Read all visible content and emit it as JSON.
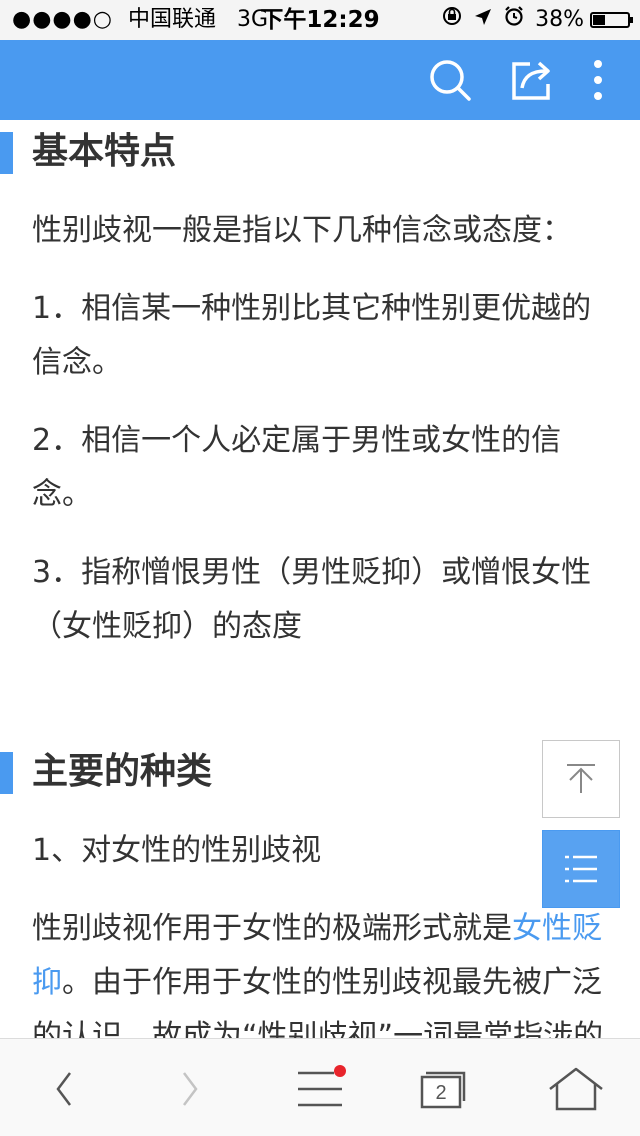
{
  "status_bar": {
    "signal": "●●●●○",
    "carrier": "中国联通",
    "network": "3G",
    "time": "下午12:29",
    "battery": "38%"
  },
  "toolbar": {
    "icons": [
      "search-icon",
      "share-icon",
      "more-vertical-icon"
    ]
  },
  "article": {
    "section1": {
      "title": "基本特点",
      "intro": "性别歧视一般是指以下几种信念或态度：",
      "items": [
        "1．相信某一种性别比其它种性别更优越的信念。",
        "2．相信一个人必定属于男性或女性的信念。",
        "3．指称憎恨男性（男性贬抑）或憎恨女性（女性贬抑）的态度"
      ]
    },
    "section2": {
      "title": "主要的种类",
      "subtitle": "1、对女性的性别歧视",
      "para_before_link": "性别歧视作用于女性的极端形式就是",
      "link_text": "女性贬抑",
      "para_after_link": "。由于作用于女性的性别歧视最先被广泛的认识，故成为“性别歧视”一词最常指涉的范围，这种形式的性别歧视表此常"
    }
  },
  "floating": {
    "icons": [
      "back-to-top-icon",
      "table-of-contents-icon"
    ]
  },
  "bottom_nav": {
    "tabs_count": "2",
    "icons": [
      "back-icon",
      "forward-icon",
      "menu-icon",
      "tabs-icon",
      "home-icon"
    ]
  },
  "colors": {
    "accent": "#4a9af0",
    "text": "#333333",
    "notification_dot": "#e8242c"
  }
}
